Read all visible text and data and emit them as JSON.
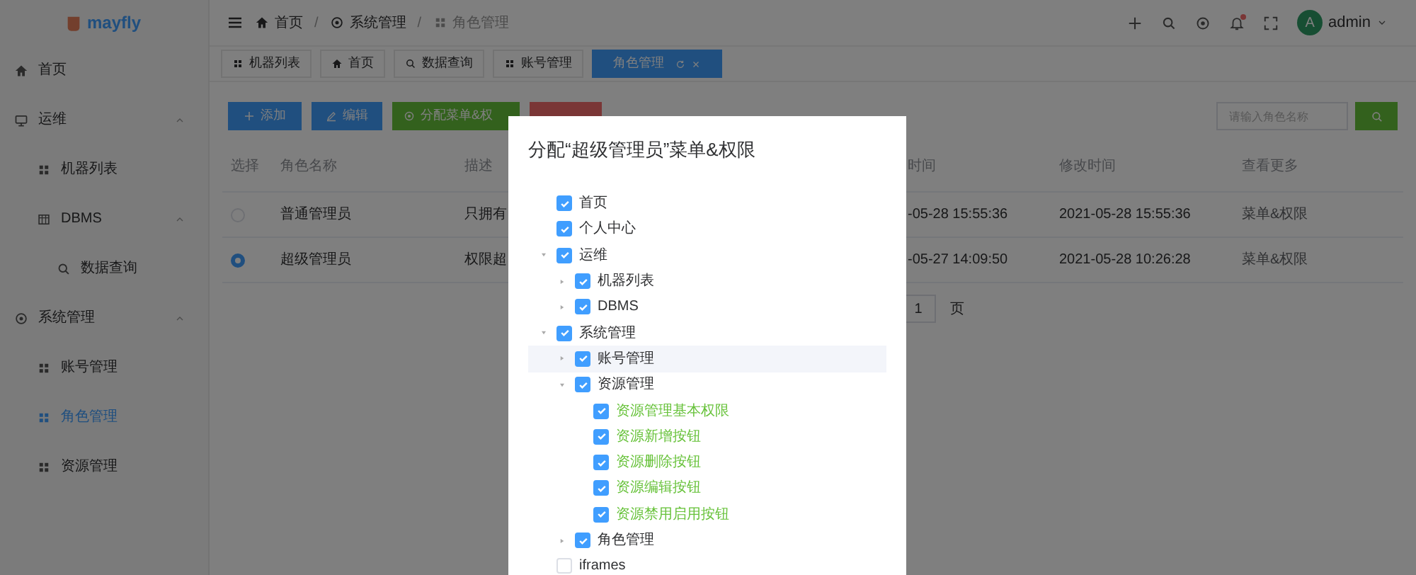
{
  "logo": {
    "text": "mayfly"
  },
  "sidebar": {
    "items": [
      {
        "label": "首页",
        "selected": false
      },
      {
        "label": "运维",
        "selected": false,
        "expanded": true,
        "children": [
          {
            "label": "机器列表",
            "selected": false
          },
          {
            "label": "DBMS",
            "selected": false,
            "expanded": true,
            "children": [
              {
                "label": "数据查询",
                "selected": false
              }
            ]
          }
        ]
      },
      {
        "label": "系统管理",
        "selected": false,
        "expanded": true,
        "children": [
          {
            "label": "账号管理",
            "selected": false
          },
          {
            "label": "角色管理",
            "selected": true
          },
          {
            "label": "资源管理",
            "selected": false
          }
        ]
      }
    ]
  },
  "breadcrumb": [
    {
      "kind": "link",
      "label": "首页"
    },
    {
      "kind": "separator",
      "label": "/"
    },
    {
      "kind": "link",
      "label": "系统管理"
    },
    {
      "kind": "separator",
      "label": "/"
    },
    {
      "kind": "current",
      "label": "角色管理"
    }
  ],
  "header": {
    "user": "admin",
    "avatar": "A",
    "notification_dot": true
  },
  "tabs": [
    {
      "label": "机器列表",
      "selected": false
    },
    {
      "label": "首页",
      "selected": false
    },
    {
      "label": "数据查询",
      "selected": false
    },
    {
      "label": "账号管理",
      "selected": false
    },
    {
      "label": "角色管理",
      "selected": true
    }
  ],
  "toolbar": {
    "buttons": [
      {
        "label": "添加",
        "kind": "add"
      },
      {
        "label": "编辑",
        "kind": "edit"
      },
      {
        "label": "分配菜单&权",
        "kind": "assign"
      },
      {
        "kind": "delete"
      }
    ],
    "search_placeholder": "请输入角色名称"
  },
  "table": {
    "columns": [
      "选择",
      "角色名称",
      "描述",
      "时间",
      "修改时间",
      "查看更多"
    ],
    "rows": [
      {
        "selected": false,
        "cells": [
          "",
          "普通管理员",
          "只拥有",
          "-05-28 15:55:36",
          "2021-05-28 15:55:36",
          "菜单&权限"
        ]
      },
      {
        "selected": true,
        "cells": [
          "",
          "超级管理员",
          "权限超",
          "-05-27 14:09:50",
          "2021-05-28 10:26:28",
          "菜单&权限"
        ]
      }
    ]
  },
  "pagination": {
    "page": "1",
    "suffix": "页"
  },
  "dialog": {
    "title": "分配“超级管理员”菜单&权限",
    "tree": [
      {
        "label": "首页",
        "kind": "menu",
        "checked": true,
        "highlighted": false
      },
      {
        "label": "个人中心",
        "kind": "menu",
        "checked": true,
        "highlighted": false
      },
      {
        "label": "运维",
        "kind": "menu",
        "checked": true,
        "highlighted": false,
        "expanded": true,
        "children": [
          {
            "label": "机器列表",
            "kind": "menu",
            "checked": true,
            "highlighted": false,
            "expanded": false
          },
          {
            "label": "DBMS",
            "kind": "menu",
            "checked": true,
            "highlighted": false,
            "expanded": false
          }
        ]
      },
      {
        "label": "系统管理",
        "kind": "menu",
        "checked": true,
        "highlighted": false,
        "expanded": true,
        "children": [
          {
            "label": "账号管理",
            "kind": "menu",
            "checked": true,
            "highlighted": true,
            "expanded": false
          },
          {
            "label": "资源管理",
            "kind": "menu",
            "checked": true,
            "highlighted": false,
            "expanded": true,
            "children": [
              {
                "label": "资源管理基本权限",
                "kind": "permission",
                "checked": true,
                "highlighted": false
              },
              {
                "label": "资源新增按钮",
                "kind": "permission",
                "checked": true,
                "highlighted": false
              },
              {
                "label": "资源删除按钮",
                "kind": "permission",
                "checked": true,
                "highlighted": false
              },
              {
                "label": "资源编辑按钮",
                "kind": "permission",
                "checked": true,
                "highlighted": false
              },
              {
                "label": "资源禁用启用按钮",
                "kind": "permission",
                "checked": true,
                "highlighted": false
              }
            ]
          },
          {
            "label": "角色管理",
            "kind": "menu",
            "checked": true,
            "highlighted": false,
            "expanded": false
          }
        ]
      },
      {
        "label": "iframes",
        "kind": "menu",
        "checked": false,
        "highlighted": false
      }
    ]
  }
}
